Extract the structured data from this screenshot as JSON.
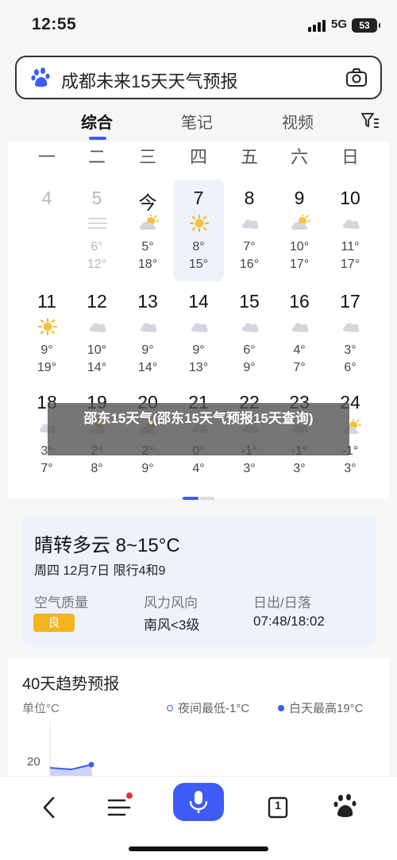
{
  "status_bar": {
    "time": "12:55",
    "network": "5G",
    "battery": "53"
  },
  "search": {
    "query": "成都未来15天天气预报",
    "logo_icon": "baidu-paw-icon",
    "camera_icon": "camera-icon"
  },
  "tabs": [
    {
      "label": "综合",
      "active": true
    },
    {
      "label": "笔记",
      "active": false
    },
    {
      "label": "视频",
      "active": false
    }
  ],
  "filter_icon": "filter-icon",
  "calendar": {
    "weekdays": [
      "一",
      "二",
      "三",
      "四",
      "五",
      "六",
      "日"
    ],
    "weeks": [
      [
        {
          "day": "4",
          "icon": "none",
          "high": "",
          "low": "",
          "state": "past"
        },
        {
          "day": "5",
          "icon": "haze-icon",
          "high": "6°",
          "low": "12°",
          "state": "past"
        },
        {
          "day": "今",
          "icon": "partly-cloudy-icon",
          "high": "5°",
          "low": "18°",
          "state": "normal"
        },
        {
          "day": "7",
          "icon": "sun-icon",
          "high": "8°",
          "low": "15°",
          "state": "today"
        },
        {
          "day": "8",
          "icon": "cloud-icon",
          "high": "7°",
          "low": "16°",
          "state": "normal"
        },
        {
          "day": "9",
          "icon": "partly-cloudy-icon",
          "high": "10°",
          "low": "17°",
          "state": "normal"
        },
        {
          "day": "10",
          "icon": "cloud-icon",
          "high": "11°",
          "low": "17°",
          "state": "normal"
        }
      ],
      [
        {
          "day": "11",
          "icon": "sun-icon",
          "high": "9°",
          "low": "19°",
          "state": "normal"
        },
        {
          "day": "12",
          "icon": "cloud-icon",
          "high": "10°",
          "low": "14°",
          "state": "normal"
        },
        {
          "day": "13",
          "icon": "cloud-icon",
          "high": "9°",
          "low": "14°",
          "state": "normal"
        },
        {
          "day": "14",
          "icon": "cloud-icon",
          "high": "9°",
          "low": "13°",
          "state": "normal"
        },
        {
          "day": "15",
          "icon": "cloud-icon",
          "high": "6°",
          "low": "9°",
          "state": "normal"
        },
        {
          "day": "16",
          "icon": "cloud-icon",
          "high": "4°",
          "low": "7°",
          "state": "normal"
        },
        {
          "day": "17",
          "icon": "cloud-icon",
          "high": "3°",
          "low": "6°",
          "state": "normal"
        }
      ],
      [
        {
          "day": "18",
          "icon": "cloud-icon",
          "high": "3°",
          "low": "7°",
          "state": "normal"
        },
        {
          "day": "19",
          "icon": "partly-cloudy-icon",
          "high": "2°",
          "low": "8°",
          "state": "normal"
        },
        {
          "day": "20",
          "icon": "partly-cloudy-icon",
          "high": "2°",
          "low": "9°",
          "state": "normal"
        },
        {
          "day": "21",
          "icon": "cloud-icon",
          "high": "0°",
          "low": "4°",
          "state": "normal"
        },
        {
          "day": "22",
          "icon": "cloud-icon",
          "high": "-1°",
          "low": "3°",
          "state": "normal"
        },
        {
          "day": "23",
          "icon": "cloud-icon",
          "high": "-1°",
          "low": "3°",
          "state": "normal"
        },
        {
          "day": "24",
          "icon": "partly-cloudy-icon",
          "high": "-1°",
          "low": "3°",
          "state": "normal"
        }
      ]
    ]
  },
  "overlay_caption": "邵东15天气(邵东15天气预报15天查询)",
  "summary": {
    "condition": "晴转多云 8~15°C",
    "date": "周四 12月7日 限行4和9",
    "air_label": "空气质量",
    "air_value": "良",
    "wind_label": "风力风向",
    "wind_value": "南风<3级",
    "sun_label": "日出/日落",
    "sun_value": "07:48/18:02"
  },
  "trend": {
    "title": "40天趋势预报",
    "unit": "单位°C",
    "legend_low": "夜间最低-1°C",
    "legend_high": "白天最高19°C",
    "y_tick": "20"
  },
  "colors": {
    "accent": "#3d5cf5",
    "badge": "#f3b51b",
    "today_bg": "#edf2fb"
  },
  "bottom_nav": {
    "back_icon": "back-icon",
    "menu_icon": "menu-icon",
    "voice_icon": "microphone-icon",
    "tabs_count": "1",
    "tabs_icon": "tabs-icon",
    "home_icon": "baidu-paw-icon"
  }
}
